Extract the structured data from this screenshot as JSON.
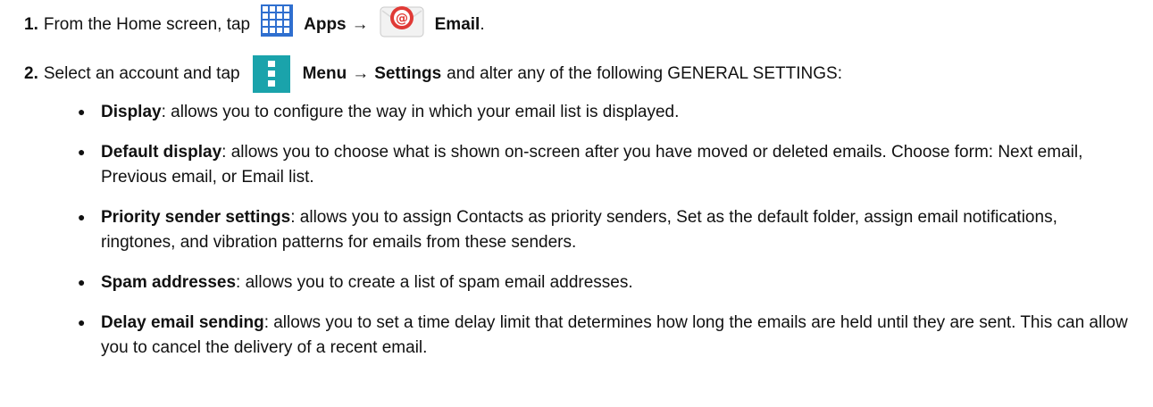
{
  "steps": [
    {
      "number": "1.",
      "text_before": "From the Home screen, tap",
      "apps_label": "Apps",
      "arrow": "→",
      "email_label": "Email",
      "end": "."
    },
    {
      "number": "2.",
      "text_before": "Select an account and tap",
      "menu_label": "Menu",
      "arrow": "→",
      "settings_label": "Settings",
      "text_after": "and alter any of the following GENERAL SETTINGS:"
    }
  ],
  "bullets": [
    {
      "term": "Display",
      "text": ": allows you to configure the way in which your email list is displayed."
    },
    {
      "term": "Default display",
      "text": ": allows you to choose what is shown on-screen after you have moved or deleted emails. Choose form: Next email, Previous email, or Email list."
    },
    {
      "term": "Priority sender settings",
      "text": ": allows you to assign Contacts as priority senders, Set as the default folder, assign email notifications, ringtones, and vibration patterns for emails from these senders."
    },
    {
      "term": "Spam addresses",
      "text": ": allows you to create a list of spam email addresses."
    },
    {
      "term": "Delay email sending",
      "text": ": allows you to set a time delay limit that determines how long the emails are held until they are sent. This can allow you to cancel the delivery of a recent email."
    }
  ],
  "icons": {
    "apps": "apps-grid-icon",
    "email": "email-app-icon",
    "menu": "menu-icon"
  },
  "colors": {
    "apps_blue": "#2f6fcf",
    "email_red": "#e03a36",
    "menu_teal": "#1aa3ab"
  }
}
